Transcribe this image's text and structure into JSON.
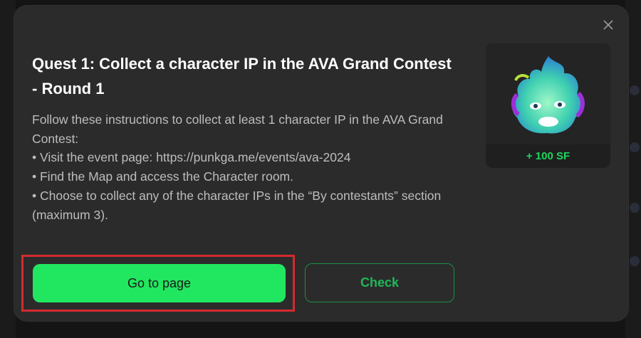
{
  "modal": {
    "close_icon": "close-icon",
    "title": "Quest 1: Collect a character IP in the AVA Grand Contest - Round 1",
    "description": {
      "intro": "Follow these instructions to collect at least 1 character IP in the AVA Grand Contest:",
      "steps": [
        "• Visit the event page: https://punkga.me/events/ava-2024",
        "• Find the Map and access the Character room.",
        "• Choose to collect any of the character IPs in the “By contestants” section (maximum 3)."
      ]
    },
    "reward": {
      "image": "green-flame-character",
      "label": "+ 100 SF"
    },
    "buttons": {
      "primary_label": "Go to page",
      "secondary_label": "Check"
    }
  },
  "colors": {
    "accent_green": "#21e760",
    "check_green": "#1fb85a",
    "highlight_red": "#d32a2f"
  }
}
